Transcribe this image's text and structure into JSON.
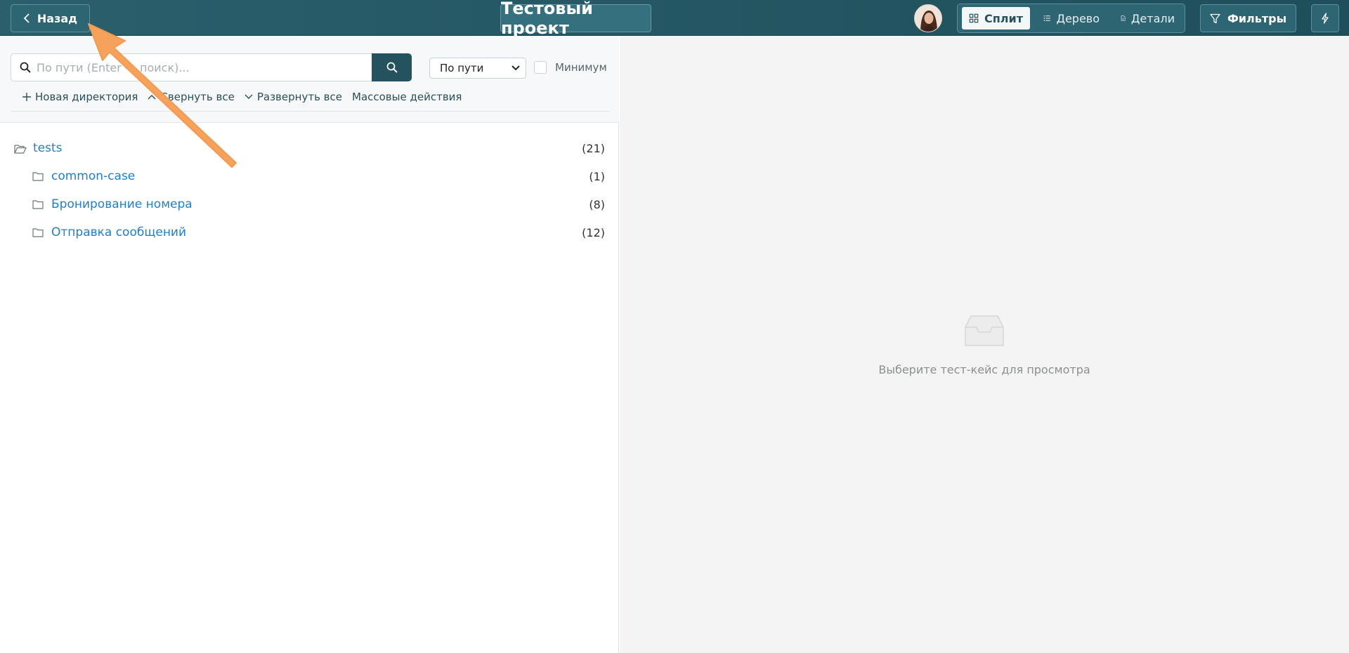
{
  "header": {
    "back_label": "Назад",
    "project_title": "Тестовый проект",
    "views": [
      {
        "label": "Сплит",
        "icon": "split-view-icon",
        "active": true
      },
      {
        "label": "Дерево",
        "icon": "list-icon",
        "active": false
      },
      {
        "label": "Детали",
        "icon": "document-icon",
        "active": false
      }
    ],
    "filters_label": "Фильтры"
  },
  "search": {
    "placeholder": "По пути (Enter — поиск)...",
    "mode": "По пути",
    "minimum_label": "Минимум"
  },
  "actions": {
    "new_dir": "Новая директория",
    "collapse_all": "Свернуть все",
    "expand_all": "Развернуть все",
    "bulk": "Массовые действия"
  },
  "tree": {
    "root": {
      "name": "tests",
      "count": "(21)"
    },
    "children": [
      {
        "name": "common-case",
        "count": "(1)"
      },
      {
        "name": "Бронирование номера",
        "count": "(8)"
      },
      {
        "name": "Отправка сообщений",
        "count": "(12)"
      }
    ]
  },
  "detail": {
    "empty_text": "Выберите тест-кейс для просмотра"
  },
  "colors": {
    "header_bg": "#24525e",
    "link": "#1e7fd0",
    "annotation_arrow": "#f7a25c"
  }
}
